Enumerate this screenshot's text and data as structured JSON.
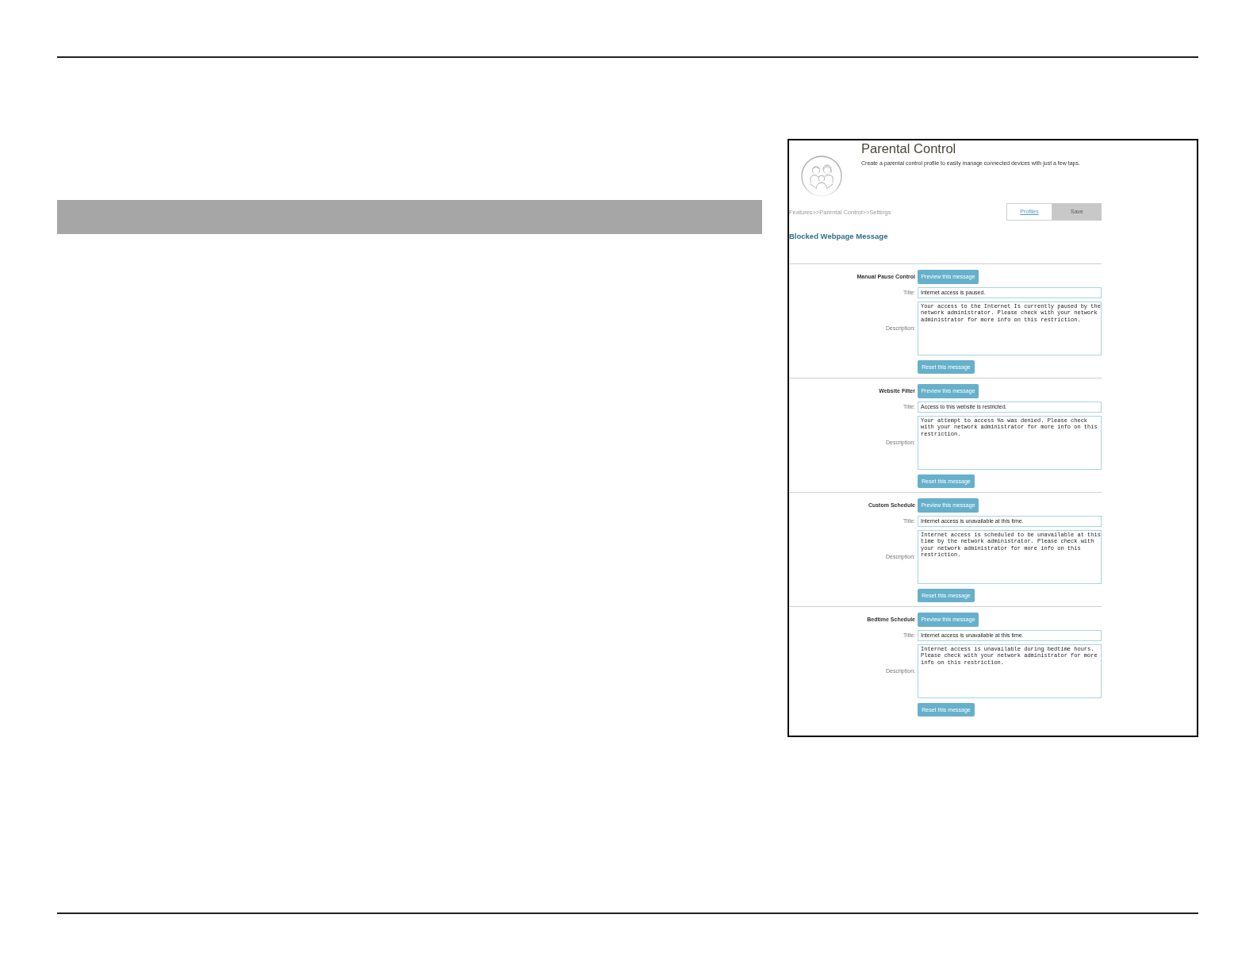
{
  "screenshot": {
    "title": "Parental Control",
    "subtitle": "Create a parental control profile to easily manage connected devices with just a few taps.",
    "breadcrumb": "Features>>Parental Control>>Settings",
    "profiles_link": "Profiles",
    "save_button": {
      "label": "Save",
      "disabled": true
    },
    "section_title": "Blocked Webpage Message",
    "messages": [
      {
        "name": "Manual Pause Control",
        "preview_button": "Preview this message",
        "title_label": "Title:",
        "title": "Internet access is paused.",
        "description_label": "Description:",
        "description": "Your access to the Internet Is currently paused by the network administrator. Please check with your network administrator for more info on this restriction.",
        "reset_button": "Reset this message"
      },
      {
        "name": "Website Filter",
        "preview_button": "Preview this message",
        "title_label": "Title:",
        "title": "Access to this website is restricted.",
        "description_label": "Description:",
        "description": "Your attempt to access %s was denied. Please check with your network administrator for more info on this restriction.",
        "reset_button": "Reset this message"
      },
      {
        "name": "Custom Schedule",
        "preview_button": "Preview this message",
        "title_label": "Title:",
        "title": "Internet access is unavailable at this time.",
        "description_label": "Description:",
        "description": "Internet access is scheduled to be unavailable at this time by the network administrator. Please check with your network administrator for more info on this restriction.",
        "reset_button": "Reset this message"
      },
      {
        "name": "Bedtime Schedule",
        "preview_button": "Preview this message",
        "title_label": "Title:",
        "title": "Internet access is unavailable at this time.",
        "description_label": "Description:",
        "description": "Internet access is unavailable during bedtime hours. Please check with your network administrator for more info on this restriction.",
        "reset_button": "Reset this message"
      }
    ]
  }
}
